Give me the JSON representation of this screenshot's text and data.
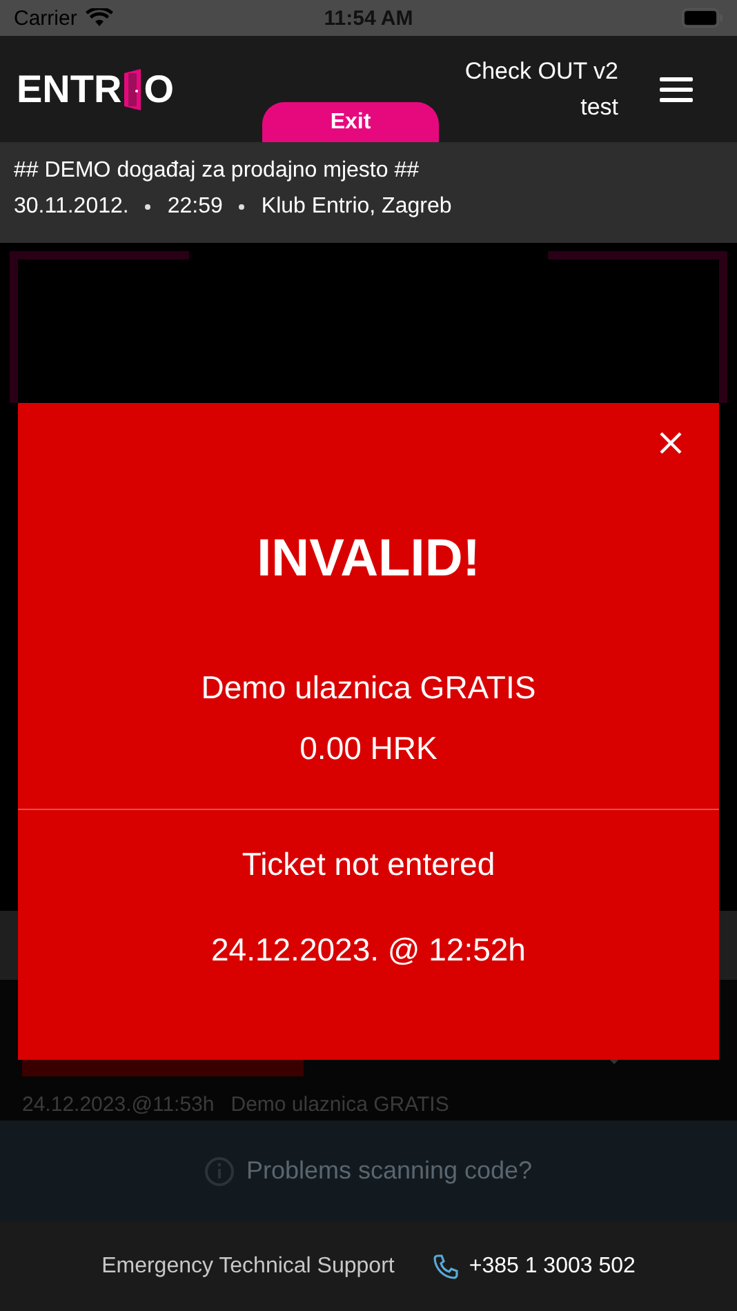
{
  "status_bar": {
    "carrier": "Carrier",
    "time": "11:54 AM"
  },
  "header": {
    "logo_start": "ENTR",
    "logo_end": "O",
    "title": "Check OUT v2",
    "subtitle": "test",
    "exit_button": "Exit"
  },
  "event": {
    "name": "## DEMO događaj za prodajno mjesto ##",
    "date": "30.11.2012.",
    "time": "22:59",
    "venue": "Klub Entrio, Zagreb"
  },
  "history": {
    "time": "24.12.2023.@11:53h",
    "ticket": "Demo ulaznica GRATIS"
  },
  "help_bar": {
    "text": "Problems scanning code?"
  },
  "footer": {
    "label": "Emergency Technical Support",
    "phone": "+385 1 3003 502"
  },
  "dialog": {
    "title": "INVALID!",
    "ticket": "Demo ulaznica GRATIS",
    "price": "0.00 HRK",
    "status": "Ticket not entered",
    "timestamp": "24.12.2023. @ 12:52h"
  }
}
